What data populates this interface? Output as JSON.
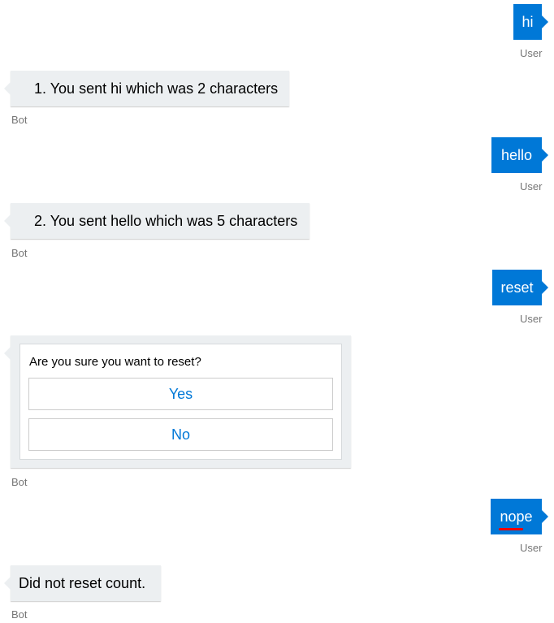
{
  "messages": [
    {
      "from": "user",
      "text": "hi",
      "label": "User"
    },
    {
      "from": "bot",
      "text": "1. You sent hi which was 2 characters",
      "label": "Bot"
    },
    {
      "from": "user",
      "text": "hello",
      "label": "User"
    },
    {
      "from": "bot",
      "text": "2. You sent hello which was 5 characters",
      "label": "Bot"
    },
    {
      "from": "user",
      "text": "reset",
      "label": "User"
    },
    {
      "from": "bot",
      "card": {
        "text": "Are you sure you want to reset?",
        "buttons": [
          "Yes",
          "No"
        ]
      },
      "label": "Bot"
    },
    {
      "from": "user",
      "text": "nope",
      "label": "User"
    },
    {
      "from": "bot",
      "text": "Did not reset count.",
      "label": "Bot"
    }
  ],
  "colors": {
    "user_bubble": "#0078d7",
    "bot_bubble": "#eceff1",
    "button_text": "#0078d7"
  }
}
